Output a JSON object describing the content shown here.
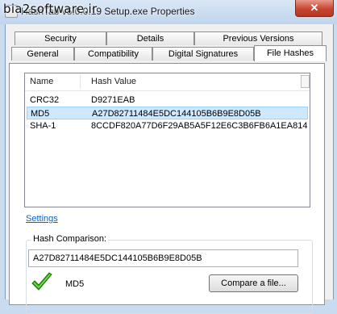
{
  "window": {
    "title": "HashTab v5.0.0.19 Setup.exe Properties",
    "watermark": "bia2software.ir",
    "close_glyph": "✕"
  },
  "tabs": {
    "row1": [
      "Security",
      "Details",
      "Previous Versions"
    ],
    "row2": [
      "General",
      "Compatibility",
      "Digital Signatures",
      "File Hashes"
    ],
    "active": "File Hashes"
  },
  "hash_list": {
    "columns": [
      "Name",
      "Hash Value"
    ],
    "rows": [
      {
        "name": "CRC32",
        "value": "D9271EAB"
      },
      {
        "name": "MD5",
        "value": "A27D82711484E5DC144105B6B9E8D05B"
      },
      {
        "name": "SHA-1",
        "value": "8CCDF820A77D6F29AB5A5F12E6C3B6FB6A1EA814"
      }
    ],
    "selected_index": 1
  },
  "settings_link": "Settings",
  "comparison": {
    "group_title": "Hash Comparison:",
    "input_value": "A27D82711484E5DC144105B6B9E8D05B",
    "match_icon": "checkmark-icon",
    "match_color": "#2fa814",
    "result_label": "MD5",
    "compare_button": "Compare a file..."
  }
}
